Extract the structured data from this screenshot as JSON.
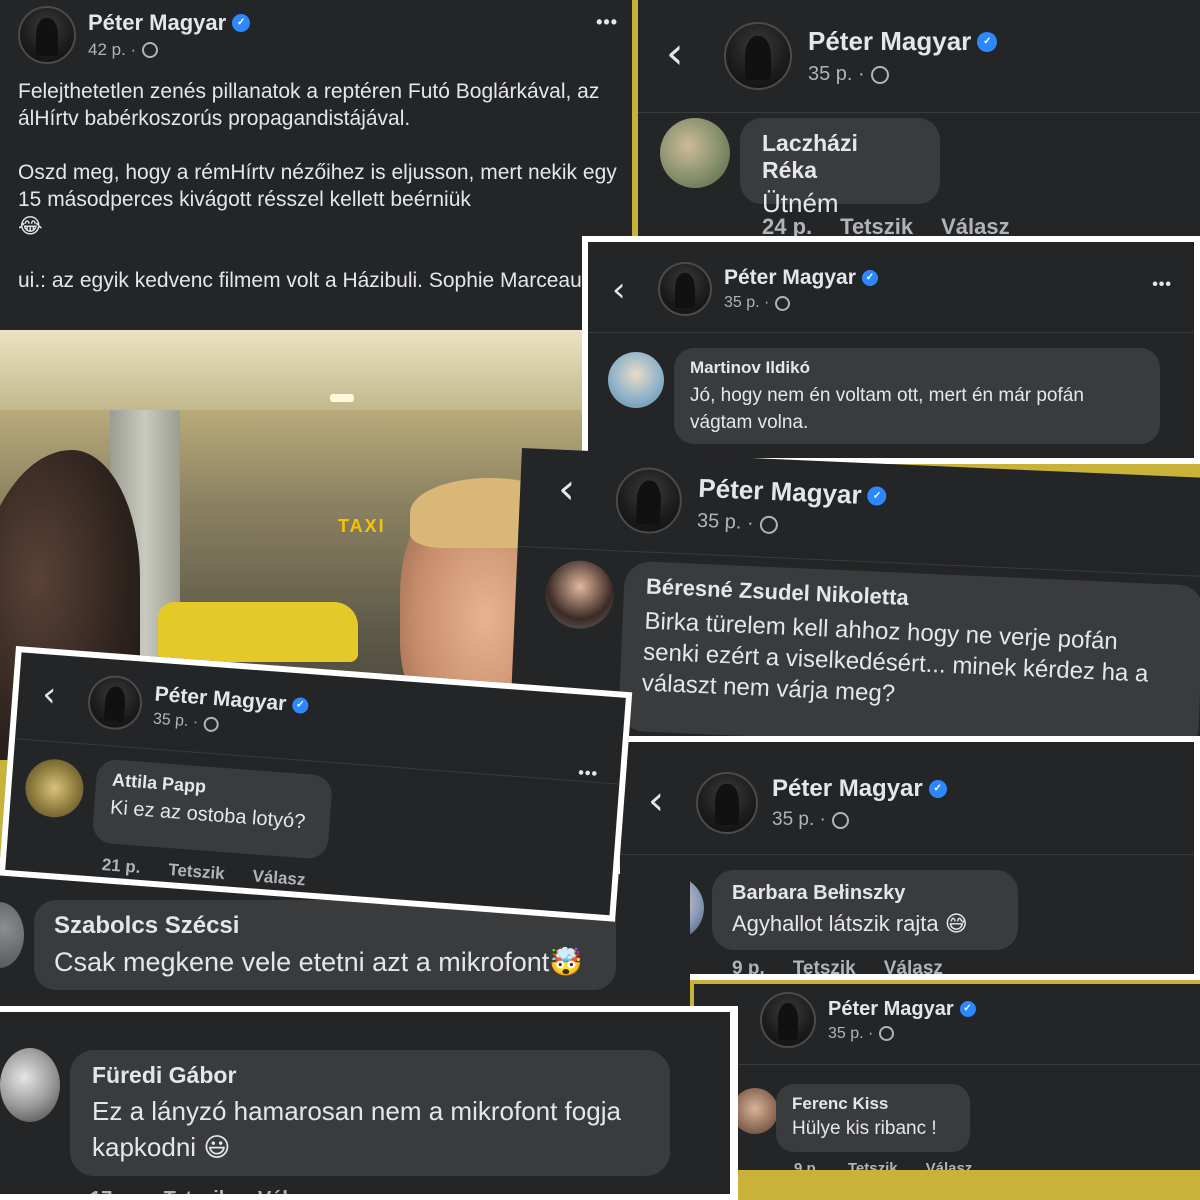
{
  "colors": {
    "panel_bg": "#242526",
    "bubble_bg": "#3a3b3c",
    "verified": "#2d88ff",
    "muted": "#b0b3b8",
    "text": "#e4e6eb",
    "backdrop": "#c9b23a"
  },
  "post": {
    "author": "Péter Magyar",
    "time": "42 p. ·",
    "more_label": "•••",
    "p1": "Felejthetetlen zenés pillanatok a reptéren Futó Boglárkával, az álHírtv babérkoszorús propagandistájával.",
    "p2": "Oszd meg, hogy a rémHírtv nézőihez is eljusson, mert nekik egy 15 másodperces kivágott résszel kellett beérniük",
    "p2_emoji": "😂",
    "p3": "ui.: az egyik kedvenc filmem volt a Házibuli. Sophie Marceau",
    "p3_emoji": "🫶",
    "photo_sign": "TAXI"
  },
  "back_icon": "‹",
  "globe_icon": "globe-icon",
  "like_label": "Tetszik",
  "reply_label": "Válasz",
  "shots": [
    {
      "author": "Péter Magyar",
      "time": "35 p. ·",
      "commenter": "Laczházi Réka",
      "text": "Ütném",
      "age": "24 p."
    },
    {
      "author": "Péter Magyar",
      "time": "35 p. ·",
      "commenter": "Martinov Ildikó",
      "text": "Jó, hogy nem én voltam ott, mert én már pofán vágtam volna.",
      "more": "•••"
    },
    {
      "author": "Péter Magyar",
      "time": "35 p. ·",
      "commenter": "Béresné Zsudel Nikoletta",
      "text": "Birka türelem kell ahhoz hogy ne verje pofán senki ezért a viselkedésért... minek kérdez ha a választ nem várja meg?"
    },
    {
      "author": "Péter Magyar",
      "time": "35 p. ·",
      "commenter": "Attila Papp",
      "text": "Ki ez az ostoba lotyó?",
      "age": "21 p.",
      "more": "•••"
    },
    {
      "author": "Péter Magyar",
      "time": "35 p. ·",
      "commenter": "Barbara Bełinszky",
      "text": "Agyhallot látszik rajta",
      "emoji": "😅",
      "age": "9 p."
    },
    {
      "commenter": "Szabolcs Szécsi",
      "text": "Csak megkene vele etetni azt a mikrofont",
      "emoji": "🤯"
    },
    {
      "author": "Péter Magyar",
      "time": "35 p. ·",
      "commenter": "Ferenc Kiss",
      "text": "Hülye kis ribanc !",
      "age": "9 p."
    },
    {
      "commenter": "Füredi Gábor",
      "text": "Ez a lányzó hamarosan nem a mikrofont fogja kapkodni",
      "emoji": "😃",
      "age": "17 p."
    }
  ]
}
